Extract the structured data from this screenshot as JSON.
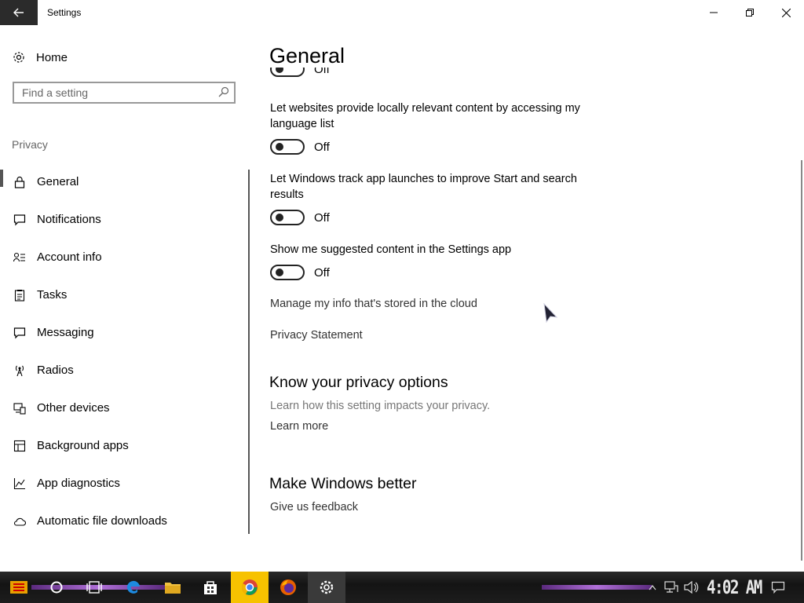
{
  "window": {
    "title": "Settings"
  },
  "sidebar": {
    "home_label": "Home",
    "search_placeholder": "Find a setting",
    "section_label": "Privacy",
    "items": [
      {
        "label": "General",
        "icon": "lock-icon",
        "active": true
      },
      {
        "label": "Notifications",
        "icon": "notification-icon"
      },
      {
        "label": "Account info",
        "icon": "account-info-icon"
      },
      {
        "label": "Tasks",
        "icon": "tasks-icon"
      },
      {
        "label": "Messaging",
        "icon": "messaging-icon"
      },
      {
        "label": "Radios",
        "icon": "radio-tower-icon"
      },
      {
        "label": "Other devices",
        "icon": "devices-icon"
      },
      {
        "label": "Background apps",
        "icon": "background-apps-icon"
      },
      {
        "label": "App diagnostics",
        "icon": "diagnostics-icon"
      },
      {
        "label": "Automatic file downloads",
        "icon": "cloud-icon"
      }
    ]
  },
  "main": {
    "title": "General",
    "partial_toggle_state": "Off",
    "settings": [
      {
        "text": "Let websites provide locally relevant content by accessing my language list",
        "state": "Off"
      },
      {
        "text": "Let Windows track app launches to improve Start and search results",
        "state": "Off"
      },
      {
        "text": "Show me suggested content in the Settings app",
        "state": "Off"
      }
    ],
    "links": {
      "manage_cloud": "Manage my info that's stored in the cloud",
      "privacy_statement": "Privacy Statement"
    },
    "privacy_options": {
      "title": "Know your privacy options",
      "description": "Learn how this setting impacts your privacy.",
      "link": "Learn more"
    },
    "make_better": {
      "title": "Make Windows better",
      "link": "Give us feedback"
    }
  },
  "taskbar": {
    "clock": "4:02 AM",
    "apps": [
      "start-icon",
      "cortana-icon",
      "task-view-icon",
      "edge-icon",
      "file-explorer-icon",
      "store-icon",
      "chrome-icon",
      "firefox-icon",
      "settings-icon"
    ]
  },
  "colors": {
    "accent_taskbar": "#f7c200",
    "text": "#000000",
    "muted": "#777777"
  }
}
